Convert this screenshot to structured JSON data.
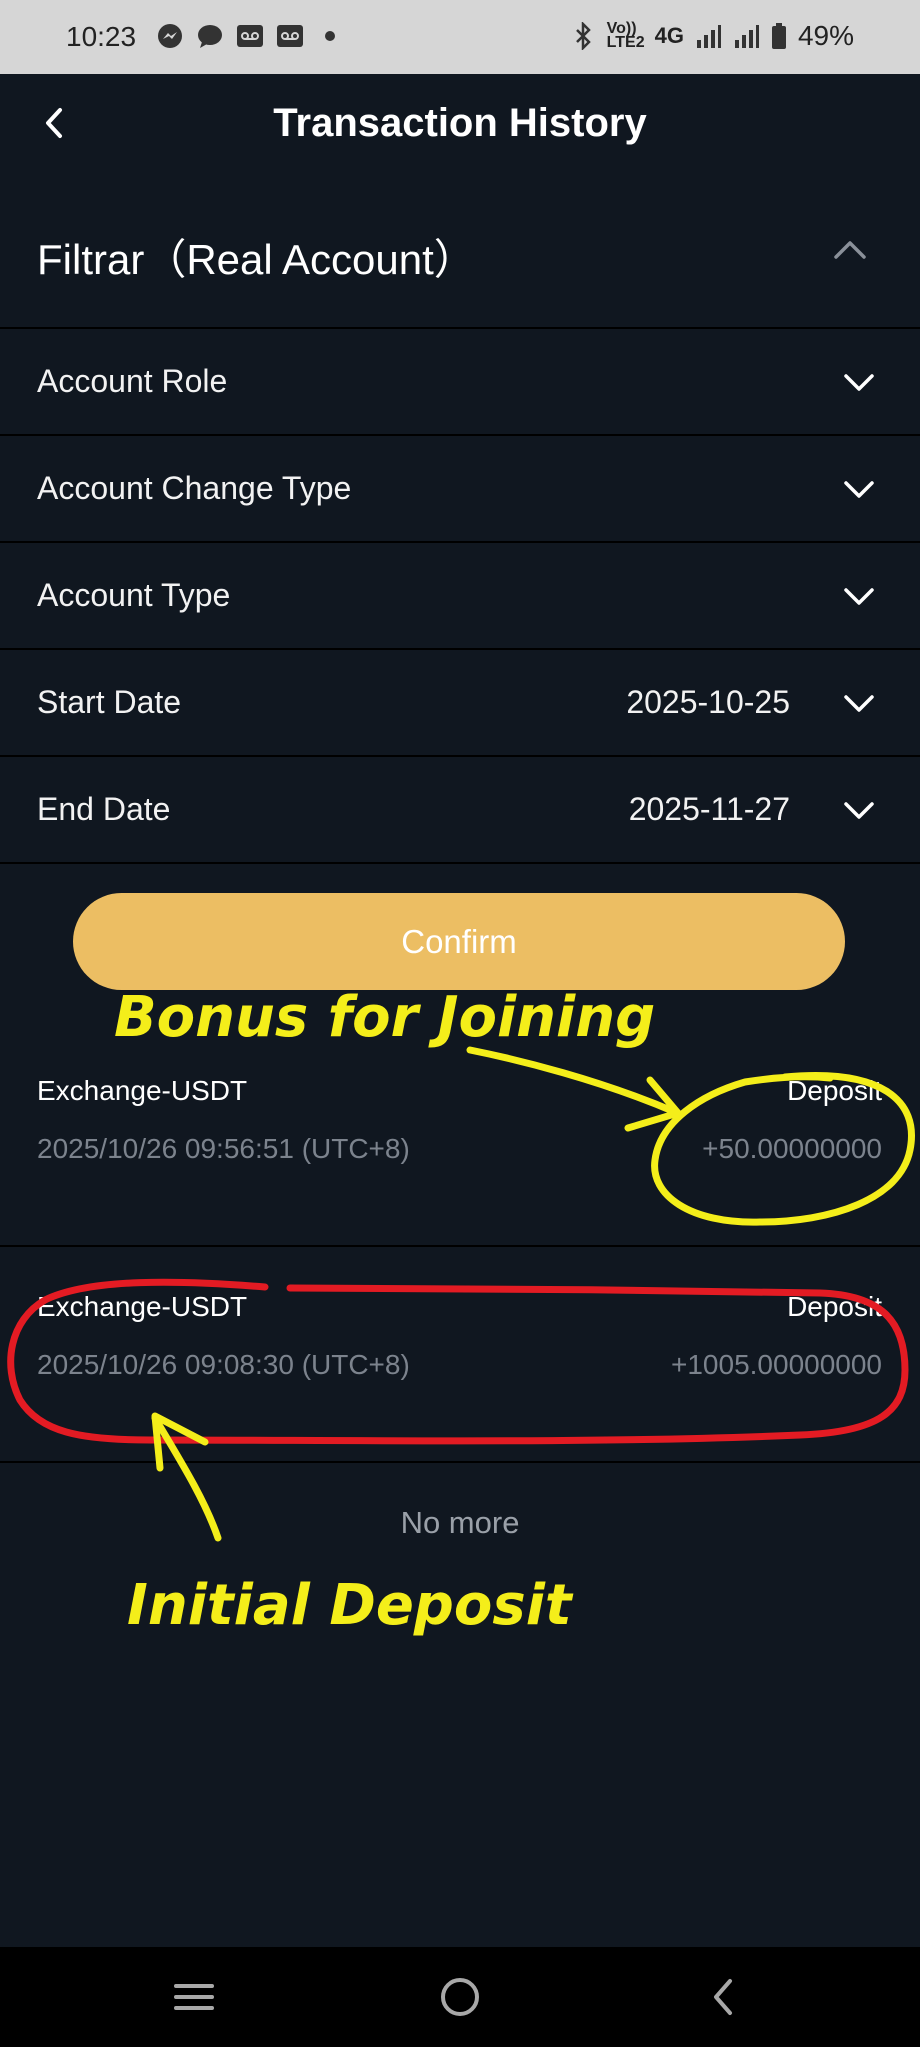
{
  "status_bar": {
    "time": "10:23",
    "left_icons": [
      "messenger-icon",
      "chat-bubble-icon",
      "voicemail-icon",
      "voicemail-icon",
      "dot-icon"
    ],
    "network_label_top": "Vo))",
    "network_label_bottom": "LTE2",
    "network_type": "4G",
    "battery": "49%"
  },
  "header": {
    "title": "Transaction History"
  },
  "filter": {
    "title": "Filtrar（Real Account）",
    "rows": [
      {
        "label": "Account Role",
        "value": ""
      },
      {
        "label": "Account Change Type",
        "value": ""
      },
      {
        "label": "Account Type",
        "value": ""
      },
      {
        "label": "Start Date",
        "value": "2025-10-25"
      },
      {
        "label": "End Date",
        "value": "2025-11-27"
      }
    ],
    "confirm_label": "Confirm"
  },
  "transactions": [
    {
      "account": "Exchange-USDT",
      "type": "Deposit",
      "time": "2025/10/26 09:56:51 (UTC+8)",
      "amount": "+50.00000000"
    },
    {
      "account": "Exchange-USDT",
      "type": "Deposit",
      "time": "2025/10/26 09:08:30 (UTC+8)",
      "amount": "+1005.00000000"
    }
  ],
  "no_more": "No more",
  "annotations": {
    "bonus": "Bonus for Joining",
    "initial": "Initial Deposit"
  },
  "colors": {
    "background": "#101720",
    "accent": "#ecbe63",
    "annotation_yellow": "#f4ee1a",
    "annotation_red": "#e31b23"
  }
}
